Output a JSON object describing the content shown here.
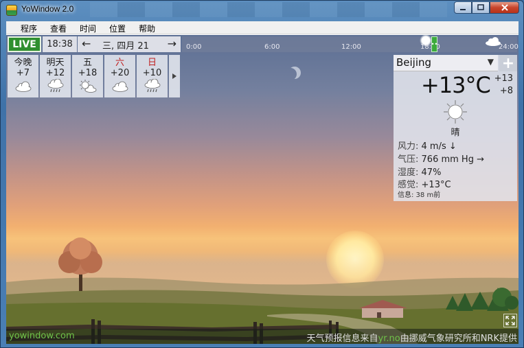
{
  "window": {
    "title": "YoWindow 2.0"
  },
  "menu": {
    "items": [
      "程序",
      "查看",
      "时间",
      "位置",
      "帮助"
    ]
  },
  "topbar": {
    "live_label": "LIVE",
    "time": "18:38",
    "date": "三, 四月 21",
    "timeline_ticks": [
      "0:00",
      "6:00",
      "12:00",
      "18:00",
      "24:00"
    ]
  },
  "forecast": [
    {
      "name": "今晚",
      "temp": "+7",
      "icon": "cloud-icon",
      "weekend": false
    },
    {
      "name": "明天",
      "temp": "+12",
      "icon": "rain-icon",
      "weekend": false
    },
    {
      "name": "五",
      "temp": "+18",
      "icon": "sun-cloud-icon",
      "weekend": false
    },
    {
      "name": "六",
      "temp": "+20",
      "icon": "cloud-icon",
      "weekend": true
    },
    {
      "name": "日",
      "temp": "+10",
      "icon": "rain-icon",
      "weekend": true
    }
  ],
  "current": {
    "location": "Beijing",
    "temp": "+13°C",
    "high": "+13",
    "low": "+8",
    "condition": "晴",
    "wind_label": "风力:",
    "wind_value": "4 m/s ↓",
    "pressure_label": "气压:",
    "pressure_value": "766 mm Hg →",
    "humidity_label": "湿度:",
    "humidity_value": "47%",
    "feels_label": "感觉:",
    "feels_value": "+13°C",
    "info": "信息: 38 m前"
  },
  "footer": {
    "site": "yowindow.com",
    "credit_prefix": "天气预报信息来自",
    "credit_link": "yr.no",
    "credit_suffix": "由挪威气象研究所和NRK提供"
  },
  "colors": {
    "live_green": "#2f8f2f",
    "link_green": "#6fc24a",
    "weekend_red": "#c02020"
  }
}
